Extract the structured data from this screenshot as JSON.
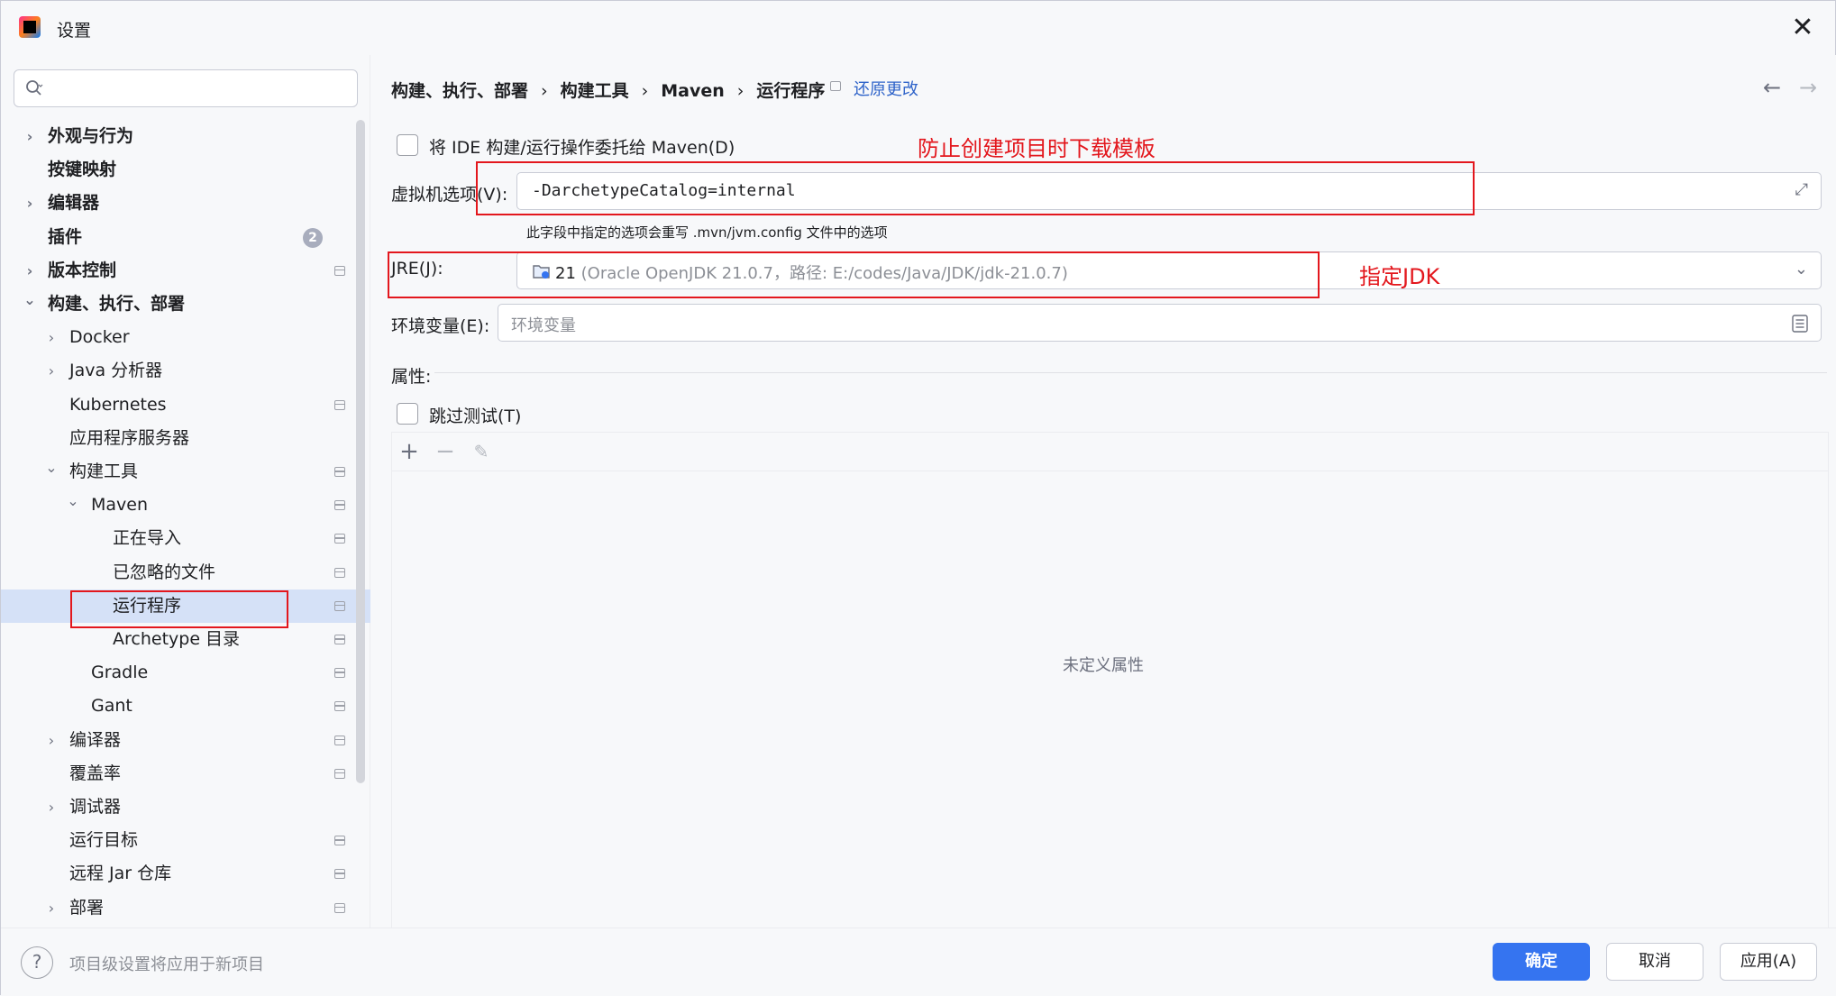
{
  "window": {
    "title": "设置"
  },
  "search": {
    "placeholder": ""
  },
  "tree": [
    {
      "label": "外观与行为",
      "bold": true,
      "chevron": "right"
    },
    {
      "label": "按键映射",
      "bold": true
    },
    {
      "label": "编辑器",
      "bold": true,
      "chevron": "right"
    },
    {
      "label": "插件",
      "bold": true,
      "badge": "2"
    },
    {
      "label": "版本控制",
      "bold": true,
      "chevron": "right"
    },
    {
      "label": "构建、执行、部署",
      "bold": true,
      "chevron": "down"
    },
    {
      "label": "Docker",
      "chevron": "right"
    },
    {
      "label": "Java 分析器",
      "chevron": "right"
    },
    {
      "label": "Kubernetes"
    },
    {
      "label": "应用程序服务器"
    },
    {
      "label": "构建工具",
      "chevron": "down"
    },
    {
      "label": "Maven",
      "chevron": "down"
    },
    {
      "label": "正在导入"
    },
    {
      "label": "已忽略的文件"
    },
    {
      "label": "运行程序",
      "selected": true
    },
    {
      "label": "Archetype 目录"
    },
    {
      "label": "Gradle"
    },
    {
      "label": "Gant"
    },
    {
      "label": "编译器",
      "chevron": "right"
    },
    {
      "label": "覆盖率"
    },
    {
      "label": "调试器",
      "chevron": "right"
    },
    {
      "label": "运行目标"
    },
    {
      "label": "远程 Jar 仓库"
    },
    {
      "label": "部署",
      "chevron": "right"
    }
  ],
  "breadcrumb": [
    "构建、执行、部署",
    "构建工具",
    "Maven",
    "运行程序"
  ],
  "breadcrumb_sep": "›",
  "reset_label": "还原更改",
  "delegate_label": "将 IDE 构建/运行操作委托给 Maven(D)",
  "vm_options": {
    "label": "虚拟机选项(V):",
    "value": "-DarchetypeCatalog=internal",
    "hint": "此字段中指定的选项会重写 .mvn/jvm.config 文件中的选项"
  },
  "jre": {
    "label": "JRE(J):",
    "value_main": "21",
    "value_detail": "(Oracle OpenJDK 21.0.7，路径: E:/codes/Java/JDK/jdk-21.0.7)"
  },
  "env": {
    "label": "环境变量(E):",
    "placeholder": "环境变量"
  },
  "props": {
    "label": "属性:",
    "skip_tests_label": "跳过测试(T)",
    "empty_text": "未定义属性"
  },
  "annotations": {
    "vm_note": "防止创建项目时下载模板",
    "jre_note": "指定JDK"
  },
  "footer": {
    "note": "项目级设置将应用于新项目",
    "ok": "确定",
    "cancel": "取消",
    "apply": "应用(A)"
  },
  "colors": {
    "accent": "#3574f0",
    "annotation": "#e3171d",
    "selection": "#d5e1f7",
    "link": "#2e63c9"
  }
}
